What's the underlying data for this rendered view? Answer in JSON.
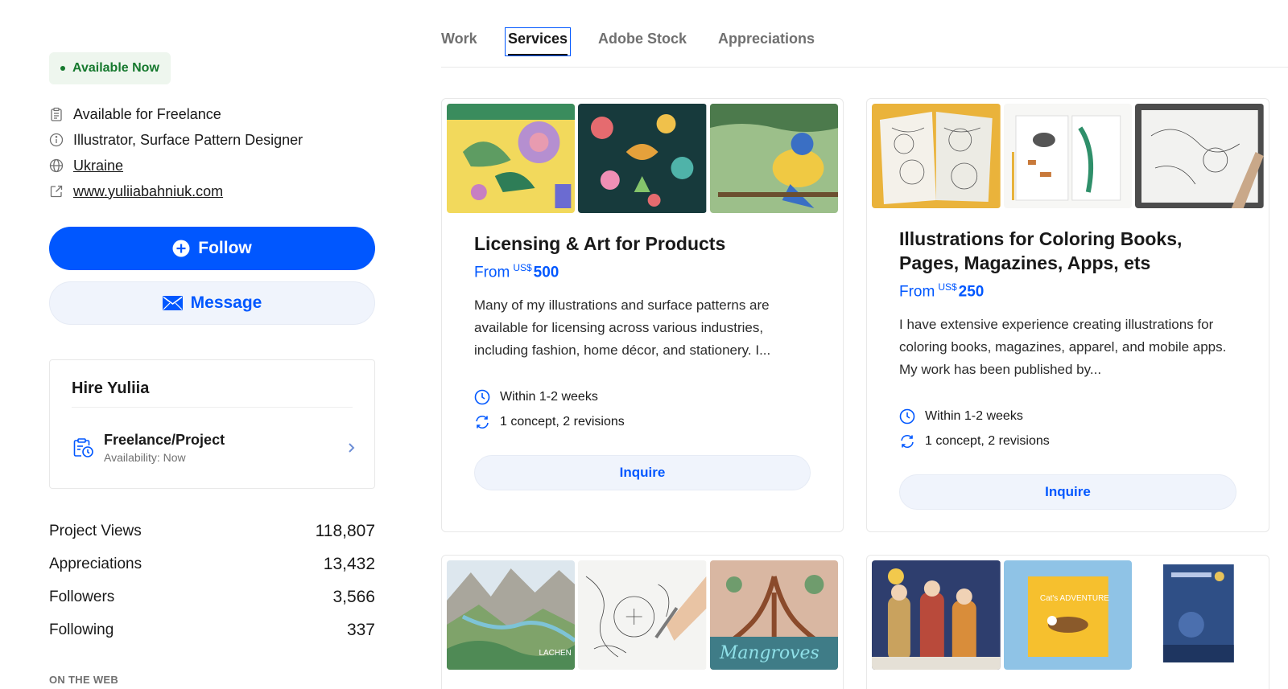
{
  "sidebar": {
    "availability_badge": "Available Now",
    "info": [
      {
        "icon": "clipboard-icon",
        "text": "Available for Freelance"
      },
      {
        "icon": "info-icon",
        "text": "Illustrator, Surface Pattern Designer"
      },
      {
        "icon": "globe-icon",
        "text": "Ukraine"
      },
      {
        "icon": "external-link-icon",
        "text": "www.yuliiabahniuk.com"
      }
    ],
    "follow_label": "Follow",
    "message_label": "Message",
    "hire": {
      "title": "Hire Yuliia",
      "item_title": "Freelance/Project",
      "item_sub": "Availability: Now"
    },
    "stats": [
      {
        "label": "Project Views",
        "value": "118,807"
      },
      {
        "label": "Appreciations",
        "value": "13,432"
      },
      {
        "label": "Followers",
        "value": "3,566"
      },
      {
        "label": "Following",
        "value": "337"
      }
    ],
    "on_the_web": "ON THE WEB"
  },
  "tabs": [
    "Work",
    "Services",
    "Adobe Stock",
    "Appreciations"
  ],
  "active_tab": "Services",
  "cards": [
    {
      "title": "Licensing & Art for Products",
      "price_prefix": "From",
      "currency": "US$",
      "amount": "500",
      "description": "Many of my illustrations and surface patterns are available for licensing across various industries, including fashion, home décor, and stationery. I...",
      "timeline": "Within 1-2 weeks",
      "revisions": "1 concept, 2 revisions",
      "cta": "Inquire"
    },
    {
      "title": "Illustrations for Coloring Books, Pages, Magazines, Apps, ets",
      "price_prefix": "From",
      "currency": "US$",
      "amount": "250",
      "description": "I have extensive experience creating illustrations for coloring books, magazines, apparel, and mobile apps. My work has been published by...",
      "timeline": "Within 1-2 weeks",
      "revisions": "1 concept, 2 revisions",
      "cta": "Inquire"
    }
  ],
  "thumb_texts": {
    "card3_mangroves": "Mangroves",
    "card3_lachen": "LACHEN",
    "card4_book": "Cat's ADVENTURE"
  },
  "colors": {
    "accent": "#0057ff",
    "available_green": "#16792e",
    "available_bg": "#eef6ee"
  }
}
